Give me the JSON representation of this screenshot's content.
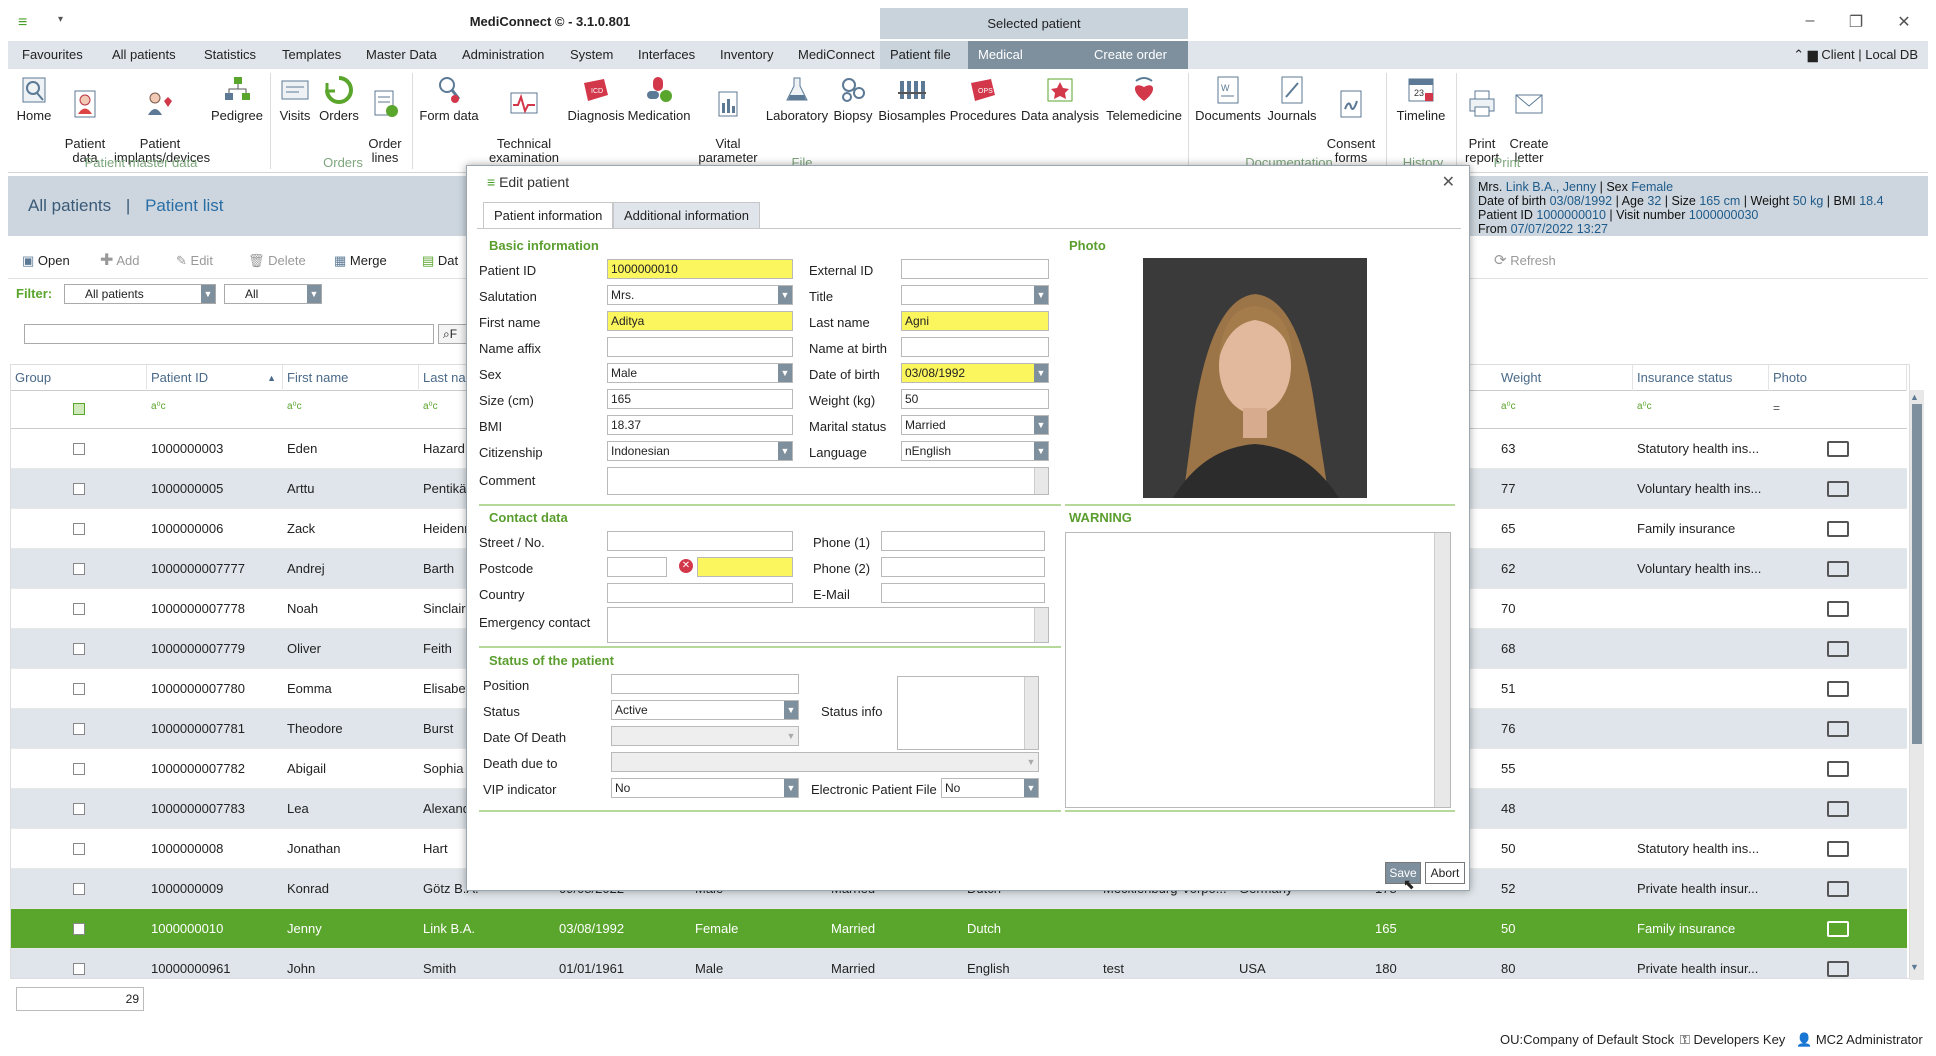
{
  "app": {
    "title": "MediConnect © - 3.1.0.801",
    "selected_patient_label": "Selected patient",
    "client_info": "Client | Local DB"
  },
  "menu": {
    "items": [
      "Favourites",
      "All patients",
      "Statistics",
      "Templates",
      "Master Data",
      "Administration",
      "System",
      "Interfaces",
      "Inventory",
      "MediConnect"
    ],
    "context_items": [
      "Patient file",
      "Medical software",
      "Create order"
    ]
  },
  "ribbon": {
    "buttons": [
      {
        "label": "Home"
      },
      {
        "label": "Patient\ndata"
      },
      {
        "label": "Patient\nimplants/devices"
      },
      {
        "label": "Pedigree"
      },
      {
        "label": "Visits"
      },
      {
        "label": "Orders"
      },
      {
        "label": "Order\nlines"
      },
      {
        "label": "Form data"
      },
      {
        "label": "Technical\nexamination"
      },
      {
        "label": "Diagnosis"
      },
      {
        "label": "Medication"
      },
      {
        "label": "Vital\nparameter"
      },
      {
        "label": "Laboratory"
      },
      {
        "label": "Biopsy"
      },
      {
        "label": "Biosamples"
      },
      {
        "label": "Procedures"
      },
      {
        "label": "Data analysis"
      },
      {
        "label": "Telemedicine"
      },
      {
        "label": "Documents"
      },
      {
        "label": "Journals"
      },
      {
        "label": "Consent\nforms"
      },
      {
        "label": "Timeline"
      },
      {
        "label": "Print\nreport"
      },
      {
        "label": "Create\nletter"
      }
    ],
    "groups": [
      "Patient master data",
      "Orders",
      "File",
      "Documentation",
      "History",
      "Print"
    ]
  },
  "list_header": {
    "crumb_root": "All patients",
    "crumb_sep": "|",
    "crumb_current": "Patient list"
  },
  "patient_summary": {
    "line1_prefix": "Mrs.",
    "name": "Link B.A., Jenny",
    "sex_label": "| Sex",
    "sex": "Female",
    "line2": "Date of birth",
    "dob": "03/08/1992",
    "age_label": "| Age",
    "age": "32",
    "size_label": "| Size",
    "size": "165 cm",
    "weight_label": "| Weight",
    "weight": "50 kg",
    "bmi_label": "| BMI",
    "bmi": "18.4",
    "pid_label": "Patient ID",
    "pid": "1000000010",
    "visit_label": "| Visit number",
    "visit": "1000000030",
    "from_label": "From",
    "from": "07/07/2022 13:27"
  },
  "toolbar": {
    "open": "Open",
    "add": "Add",
    "edit": "Edit",
    "delete": "Delete",
    "merge": "Merge",
    "data": "Dat",
    "refresh": "Refresh"
  },
  "filter": {
    "label": "Filter:",
    "patients_value": "All patients",
    "status_value": "All",
    "search_placeholder": "",
    "find_btn": "F"
  },
  "grid": {
    "columns": [
      "Group",
      "Patient ID",
      "First name",
      "Last na",
      "Weight",
      "Insurance status",
      "Photo"
    ],
    "filter_row": [
      "",
      "a⁰c",
      "a⁰c",
      "a⁰c",
      "a⁰c",
      "a⁰c",
      "="
    ],
    "rows": [
      {
        "id": "1000000003",
        "first": "Eden",
        "last": "Hazard",
        "weight": "63",
        "ins": "Statutory health ins...",
        "extra": [
          "",
          "",
          "",
          "",
          "",
          "",
          "",
          ""
        ]
      },
      {
        "id": "1000000005",
        "first": "Arttu",
        "last": "Pentikäin",
        "weight": "77",
        "ins": "Voluntary health ins...",
        "extra": [
          "",
          "",
          "",
          "",
          "",
          "",
          "",
          ""
        ]
      },
      {
        "id": "1000000006",
        "first": "Zack",
        "last": "Heidenr",
        "weight": "65",
        "ins": "Family insurance",
        "extra": [
          "",
          "",
          "",
          "",
          "",
          "",
          "",
          ""
        ]
      },
      {
        "id": "1000000007777",
        "first": "Andrej",
        "last": "Barth",
        "weight": "62",
        "ins": "Voluntary health ins...",
        "extra": [
          "",
          "",
          "",
          "",
          "",
          "",
          "",
          ""
        ]
      },
      {
        "id": "1000000007778",
        "first": "Noah",
        "last": "Sinclair",
        "weight": "70",
        "ins": "",
        "extra": [
          "",
          "",
          "",
          "",
          "",
          "",
          "",
          ""
        ]
      },
      {
        "id": "1000000007779",
        "first": "Oliver",
        "last": "Feith",
        "weight": "68",
        "ins": "",
        "extra": [
          "",
          "",
          "",
          "",
          "",
          "",
          "",
          ""
        ]
      },
      {
        "id": "1000000007780",
        "first": "Eomma",
        "last": "Elisabet",
        "weight": "51",
        "ins": "",
        "extra": [
          "",
          "",
          "",
          "",
          "",
          "",
          "",
          ""
        ]
      },
      {
        "id": "1000000007781",
        "first": "Theodore",
        "last": "Burst",
        "weight": "76",
        "ins": "",
        "extra": [
          "",
          "",
          "",
          "",
          "",
          "",
          "",
          ""
        ]
      },
      {
        "id": "1000000007782",
        "first": "Abigail",
        "last": "Sophia",
        "weight": "55",
        "ins": "",
        "extra": [
          "",
          "",
          "",
          "",
          "",
          "",
          "",
          ""
        ]
      },
      {
        "id": "1000000007783",
        "first": "Lea",
        "last": "Alexand",
        "weight": "48",
        "ins": "",
        "extra": [
          "",
          "",
          "",
          "",
          "",
          "",
          "",
          ""
        ]
      },
      {
        "id": "1000000008",
        "first": "Jonathan",
        "last": "Hart",
        "weight": "50",
        "ins": "Statutory health ins...",
        "extra": [
          "",
          "",
          "",
          "",
          "",
          "",
          "",
          ""
        ]
      },
      {
        "id": "1000000009",
        "first": "Konrad",
        "last": "Götz B.A.",
        "weight": "52",
        "ins": "Private health insur...",
        "extra": [
          "09/08/2022",
          "Male",
          "Married",
          "Dutch",
          "Mecklenburg-Vorpo...",
          "Germany",
          "178",
          ""
        ]
      },
      {
        "id": "1000000010",
        "first": "Jenny",
        "last": "Link B.A.",
        "weight": "50",
        "ins": "Family insurance",
        "extra": [
          "03/08/1992",
          "Female",
          "Married",
          "Dutch",
          "",
          "",
          "165",
          ""
        ]
      },
      {
        "id": "10000000961",
        "first": "John",
        "last": "Smith",
        "weight": "80",
        "ins": "Private health insur...",
        "extra": [
          "01/01/1961",
          "Male",
          "Married",
          "English",
          "test",
          "USA",
          "180",
          ""
        ]
      }
    ],
    "count": "29"
  },
  "statusbar": {
    "ou": "OU:Company of Default Stock",
    "dev_key": "Developers Key",
    "user": "MC2 Administrator"
  },
  "dialog": {
    "title": "Edit patient",
    "tabs": [
      "Patient information",
      "Additional information"
    ],
    "sections": {
      "basic": "Basic information",
      "photo": "Photo",
      "contact": "Contact data",
      "warning": "WARNING",
      "status": "Status of the patient"
    },
    "basic": {
      "patient_id_label": "Patient ID",
      "patient_id": "1000000010",
      "external_id_label": "External ID",
      "external_id": "",
      "salutation_label": "Salutation",
      "salutation": "Mrs.",
      "title_label": "Title",
      "title": "",
      "first_name_label": "First name",
      "first_name": "Aditya",
      "last_name_label": "Last name",
      "last_name": "Agni",
      "name_affix_label": "Name affix",
      "name_affix": "",
      "name_at_birth_label": "Name at birth",
      "name_at_birth": "",
      "sex_label": "Sex",
      "sex": "Male",
      "dob_label": "Date of birth",
      "dob": "03/08/1992",
      "size_label": "Size (cm)",
      "size": "165",
      "weight_label": "Weight (kg)",
      "weight": "50",
      "bmi_label": "BMI",
      "bmi": "18.37",
      "marital_label": "Marital status",
      "marital": "Married",
      "citizenship_label": "Citizenship",
      "citizenship": "Indonesian",
      "language_label": "Language",
      "language": "nEnglish",
      "comment_label": "Comment",
      "comment": ""
    },
    "contact": {
      "street_label": "Street / No.",
      "street": "",
      "phone1_label": "Phone (1)",
      "phone1": "",
      "postcode_label": "Postcode",
      "postcode": "",
      "city": "",
      "phone2_label": "Phone (2)",
      "phone2": "",
      "country_label": "Country",
      "country": "",
      "email_label": "E-Mail",
      "email": "",
      "emergency_label": "Emergency contact",
      "emergency": ""
    },
    "status": {
      "position_label": "Position",
      "position": "",
      "status_label": "Status",
      "status": "Active",
      "status_info_label": "Status info",
      "status_info": "",
      "date_of_death_label": "Date Of Death",
      "date_of_death": "",
      "death_due_label": "Death due to",
      "death_due": "",
      "vip_label": "VIP indicator",
      "vip": "No",
      "epf_label": "Electronic Patient File",
      "epf": "No"
    },
    "buttons": {
      "save": "Save",
      "abort": "Abort"
    }
  },
  "colors": {
    "accent_green": "#5aa52c",
    "required_yellow": "#fbf55e",
    "header_blue": "#cdd6de",
    "dropdown_gray": "#7e8f9e"
  }
}
